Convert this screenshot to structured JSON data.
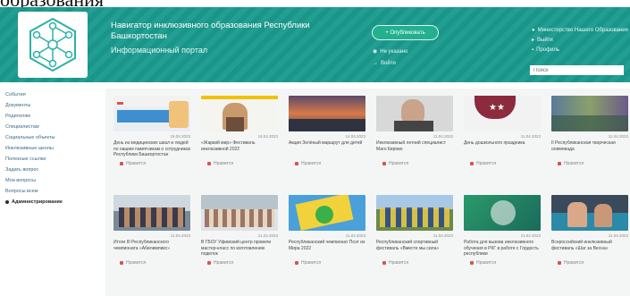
{
  "page_heading": "образования",
  "header": {
    "title": "Навигатор инклюзивного образования Республики Башкортостан",
    "subtitle": "Информационный портал",
    "button_label": "+ Опубликовать",
    "link_1": "Не указано",
    "link_2": "Войти",
    "user_name": "Министерство Нашего Образования",
    "user_link_1": "Выйти",
    "user_link_2": "Профиль",
    "search_placeholder": "Поиск"
  },
  "sidebar": {
    "items": [
      {
        "label": "События",
        "active": false
      },
      {
        "label": "Документы",
        "active": false
      },
      {
        "label": "Родителям",
        "active": false
      },
      {
        "label": "Специалистам",
        "active": false
      },
      {
        "label": "Социальные объекты",
        "active": false
      },
      {
        "label": "Инклюзивные школы",
        "active": false
      },
      {
        "label": "Полезные ссылки",
        "active": false
      },
      {
        "label": "Задать вопрос",
        "active": false
      },
      {
        "label": "Мои вопросы",
        "active": false
      },
      {
        "label": "Вопросы всем",
        "active": false
      },
      {
        "label": "Администрирование",
        "active": true
      }
    ]
  },
  "cards": [
    {
      "date": "19.04.2023",
      "title": "День из медицинских шкал и людей по нашим памятникам о сотрудниках Республики Башкортостан",
      "like": "Нравится"
    },
    {
      "date": "19.04.2023",
      "title": "«Жаркий мир» Фестиваль инклюзивной 2022",
      "like": "Нравится"
    },
    {
      "date": "14.04.2023",
      "title": "Акция Зелёный маршрут для детей",
      "like": "Нравится"
    },
    {
      "date": "11.04.2023",
      "title": "Инклюзивный летний специалист Маго Кирово",
      "like": "Нравится"
    },
    {
      "date": "11.04.2023",
      "title": "День дошкольного праздника",
      "like": "Нравится"
    },
    {
      "date": "11.04.2023",
      "title": "II Республиканская творческая олимпиада",
      "like": "Нравится"
    },
    {
      "date": "11.04.2023",
      "title": "Итоги III Республиканского чемпионата «Абилимпикс»",
      "like": "Нравится"
    },
    {
      "date": "11.04.2023",
      "title": "В ГБОУ Уфимский центр провели мастер-класс по изготовлению поделок",
      "like": "Нравится"
    },
    {
      "date": "11.04.2023",
      "title": "Республиканский чемпионат Поэт из Мира 2022",
      "like": "Нравится"
    },
    {
      "date": "11.04.2023",
      "title": "Республиканский спортивный фестиваль «Вместе мы сила»",
      "like": "Нравится"
    },
    {
      "date": "11.04.2023",
      "title": "Работа для вызова инклюзивного обучения в РКГ в работе с Гордость республики",
      "like": "Нравится"
    },
    {
      "date": "11.04.2023",
      "title": "Всероссийский инклюзивный фестиваль «Шаг за Весна»",
      "like": "Нравится"
    }
  ],
  "colors": {
    "header": "#1a9a8e",
    "accent": "#23b08f",
    "link": "#3a6a8a"
  }
}
